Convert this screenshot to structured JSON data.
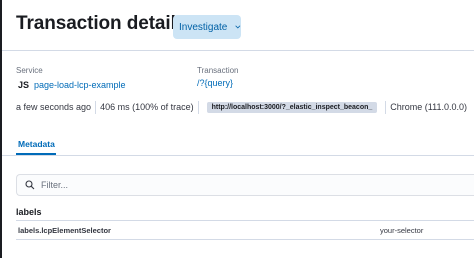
{
  "header": {
    "title": "Transaction details",
    "investigate_label": "Investigate"
  },
  "summary": {
    "service_label": "Service",
    "service_badge": "JS",
    "service_name": "page-load-lcp-example",
    "transaction_label": "Transaction",
    "transaction_name": "/?{query}"
  },
  "meta": {
    "timestamp": "a few seconds ago",
    "duration": "406 ms (100% of trace)",
    "url": "http://localhost:3000/?_elastic_inspect_beacon_",
    "user_agent": "Chrome (111.0.0.0)"
  },
  "tabs": [
    {
      "label": "Metadata",
      "active": true
    }
  ],
  "search": {
    "placeholder": "Filter...",
    "value": ""
  },
  "labels_section": {
    "title": "labels",
    "rows": [
      {
        "key": "labels.lcpElementSelector",
        "value": "your-selector"
      }
    ]
  },
  "colors": {
    "accent": "#006bb8",
    "button_bg": "#cce4f5",
    "border": "#d3dae6"
  }
}
